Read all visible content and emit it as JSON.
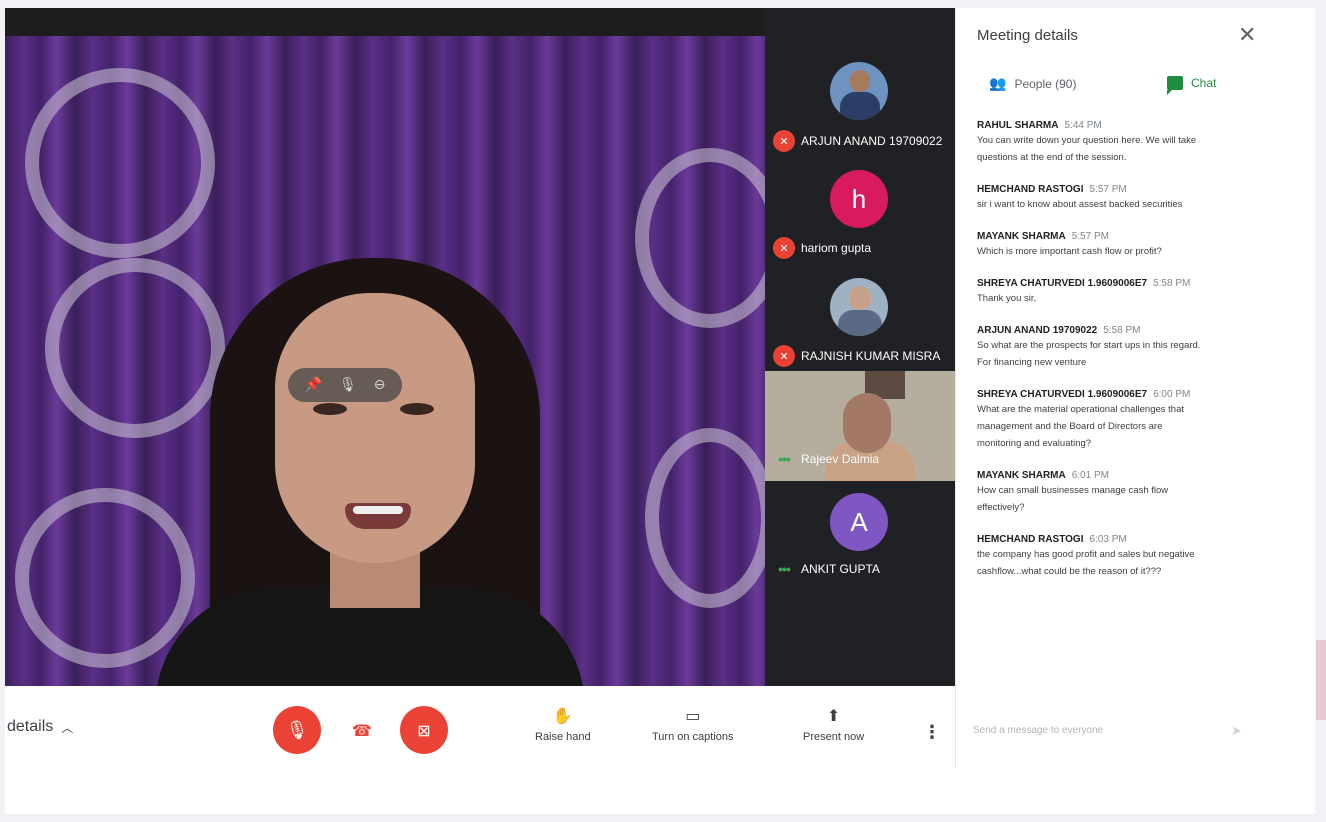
{
  "tiles": [
    {
      "name": "ARJUN ANAND 19709022",
      "status": "muted",
      "avatar": "photo"
    },
    {
      "name": "hariom gupta",
      "status": "muted",
      "avatar": "letter",
      "letter": "h",
      "color": "#d81b60"
    },
    {
      "name": "RAJNISH KUMAR MISRA",
      "status": "muted",
      "avatar": "photo"
    },
    {
      "name": "Rajeev Dalmia",
      "status": "speaking",
      "avatar": "video"
    },
    {
      "name": "ANKIT GUPTA",
      "status": "speaking",
      "avatar": "letter",
      "letter": "A",
      "color": "#7e57c2"
    }
  ],
  "bottom": {
    "details_label": "details",
    "raise_hand": "Raise hand",
    "captions": "Turn on captions",
    "present": "Present now"
  },
  "panel": {
    "title": "Meeting details",
    "people_tab": "People (90)",
    "chat_tab": "Chat",
    "send_placeholder": "Send a message to everyone"
  },
  "messages": [
    {
      "sender": "RAHUL SHARMA",
      "time": "5:44 PM",
      "lines": [
        "You can write down your question here. We will take",
        "questions at the end of the session."
      ]
    },
    {
      "sender": "HEMCHAND RASTOGI",
      "time": "5:57 PM",
      "lines": [
        "sir i want to know about assest backed securities"
      ]
    },
    {
      "sender": "MAYANK SHARMA",
      "time": "5:57 PM",
      "lines": [
        "Which is more important cash flow or profit?"
      ]
    },
    {
      "sender": "SHREYA CHATURVEDI 1.9609006E7",
      "time": "5:58 PM",
      "lines": [
        "Thank you sir,"
      ]
    },
    {
      "sender": "ARJUN ANAND 19709022",
      "time": "5:58 PM",
      "lines": [
        "So what are the prospects for start ups in this regard.",
        "For financing new venture"
      ]
    },
    {
      "sender": "SHREYA CHATURVEDI 1.9609006E7",
      "time": "6:00 PM",
      "lines": [
        "What are the material operational challenges that",
        "management and the Board of Directors are",
        "monitoring and evaluating?"
      ]
    },
    {
      "sender": "MAYANK SHARMA",
      "time": "6:01 PM",
      "lines": [
        "How can small businesses manage cash flow",
        "effectively?"
      ]
    },
    {
      "sender": "HEMCHAND RASTOGI",
      "time": "6:03 PM",
      "lines": [
        "the company  has good profit and sales but negative",
        "cashflow...what could be the reason of it???"
      ]
    }
  ],
  "colors": {
    "accent_red": "#ea4335",
    "chat_green": "#1e8e3e",
    "tile_bg": "#202124"
  }
}
